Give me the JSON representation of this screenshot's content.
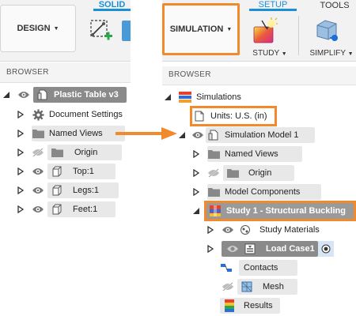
{
  "left": {
    "workspace_button": "DESIGN",
    "tab_solid": "SOLID",
    "browser_title": "BROWSER",
    "tree": {
      "root": "Plastic Table v3",
      "items": [
        {
          "label": "Document Settings",
          "icon": "gear-icon"
        },
        {
          "label": "Named Views",
          "icon": "folder-icon"
        },
        {
          "label": "Origin",
          "icon": "folder-icon"
        },
        {
          "label": "Top:1",
          "icon": "body-icon"
        },
        {
          "label": "Legs:1",
          "icon": "body-icon"
        },
        {
          "label": "Feet:1",
          "icon": "body-icon"
        }
      ]
    }
  },
  "right": {
    "workspace_button": "SIMULATION",
    "tab_setup": "SETUP",
    "tab_tools": "TOOLS",
    "study_label": "STUDY",
    "simplify_label": "SIMPLIFY",
    "browser_title": "BROWSER",
    "tree": {
      "simulations": "Simulations",
      "units": "Units: U.S. (in)",
      "model": "Simulation Model 1",
      "model_items": [
        {
          "label": "Named Views"
        },
        {
          "label": "Origin"
        },
        {
          "label": "Model Components"
        }
      ],
      "study": "Study 1 - Structural Buckling",
      "study_items": [
        {
          "label": "Study Materials"
        },
        {
          "label": "Load Case1"
        },
        {
          "label": "Contacts"
        },
        {
          "label": "Mesh"
        },
        {
          "label": "Results"
        }
      ]
    }
  },
  "colors": {
    "highlight": "#f08a2c",
    "tab_blue": "#1a8fd8"
  }
}
